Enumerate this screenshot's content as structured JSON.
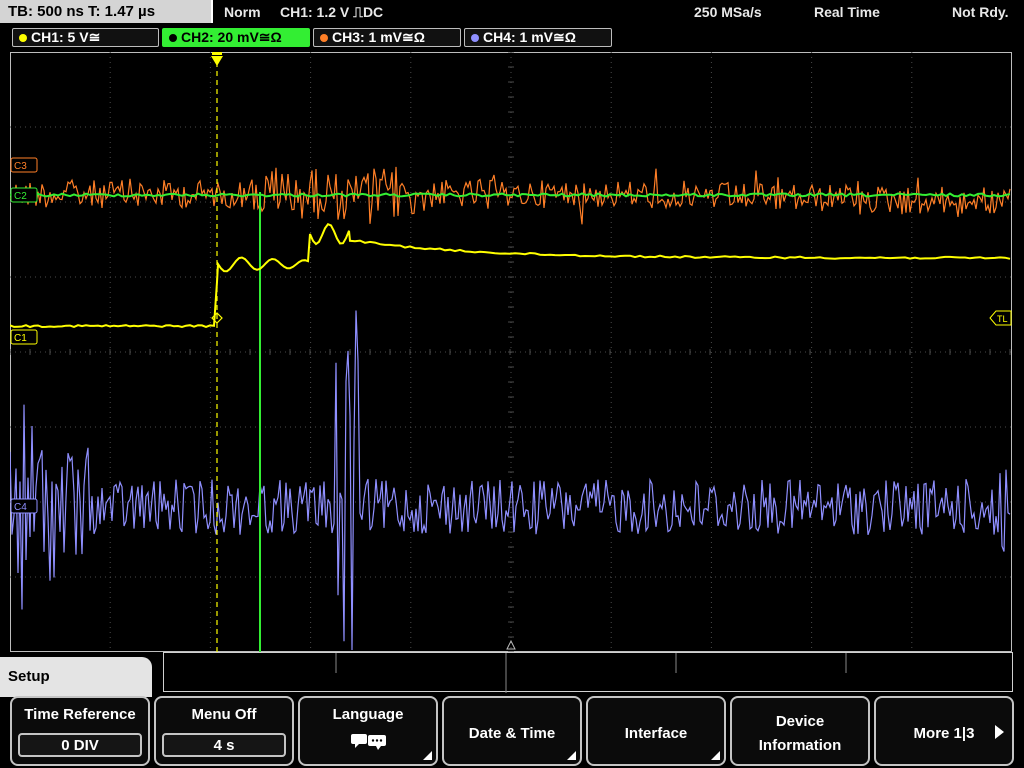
{
  "top_bar": {
    "timebase": "TB: 500 ns   T: 1.47 µs",
    "mode": "Norm",
    "trigger": "CH1: 1.2 V ⎍DC",
    "sample_rate": "250 MSa/s",
    "acquisition": "Real Time",
    "status": "Not Rdy."
  },
  "channels": [
    {
      "label": "CH1: 5 V≅",
      "color": "#ffff00"
    },
    {
      "label": "CH2: 20 mV≅Ω",
      "color": "#33ee33",
      "active": true
    },
    {
      "label": "CH3: 1 mV≅Ω",
      "color": "#ff7f27"
    },
    {
      "label": "CH4: 1 mV≅Ω",
      "color": "#8f8fff"
    }
  ],
  "markers": {
    "ch1": "C1",
    "ch3": "C3",
    "ch2": "C2",
    "ch4": "C4",
    "trigger_level": "TL"
  },
  "menu": {
    "title": "Setup",
    "softkeys": [
      {
        "label": "Time Reference",
        "value": "0 DIV"
      },
      {
        "label": "Menu Off",
        "value": "4 s"
      },
      {
        "label": "Language",
        "icon": "speech-bubbles-icon"
      },
      {
        "label": "Date & Time"
      },
      {
        "label": "Interface"
      },
      {
        "label": "Device Information",
        "line1": "Device",
        "line2": "Information"
      },
      {
        "label": "More 1|3"
      }
    ]
  },
  "colors": {
    "ch1": "#ffff00",
    "ch2": "#33ee33",
    "ch3": "#ff7f27",
    "ch4": "#8f8fff",
    "grid": "#4a4a4a"
  }
}
